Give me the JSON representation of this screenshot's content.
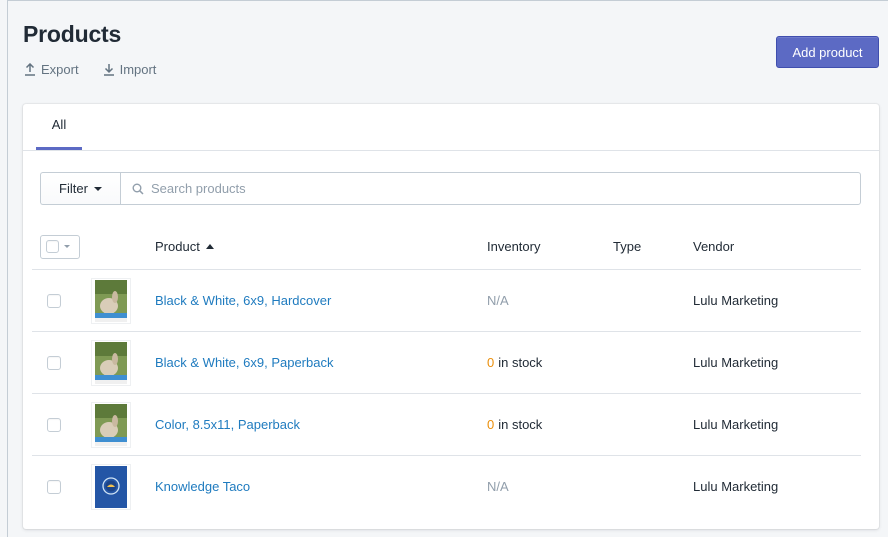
{
  "page": {
    "title": "Products",
    "export_label": "Export",
    "import_label": "Import",
    "add_product_label": "Add product"
  },
  "tabs": [
    {
      "label": "All",
      "selected": true
    }
  ],
  "filter": {
    "button_label": "Filter",
    "search_placeholder": "Search products"
  },
  "table": {
    "columns": {
      "product": "Product",
      "inventory": "Inventory",
      "type": "Type",
      "vendor": "Vendor"
    },
    "sort": {
      "column": "product",
      "direction": "ascending"
    },
    "rows": [
      {
        "name": "Black & White, 6x9, Hardcover",
        "inventory": "N/A",
        "inventory_count": "",
        "inventory_suffix": "",
        "type": "",
        "vendor": "Lulu Marketing",
        "thumbnail": "rabbit-cover-image"
      },
      {
        "name": "Black & White, 6x9, Paperback",
        "inventory": "",
        "inventory_count": "0",
        "inventory_suffix": "in stock",
        "type": "",
        "vendor": "Lulu Marketing",
        "thumbnail": "rabbit-cover-image"
      },
      {
        "name": "Color, 8.5x11, Paperback",
        "inventory": "",
        "inventory_count": "0",
        "inventory_suffix": "in stock",
        "type": "",
        "vendor": "Lulu Marketing",
        "thumbnail": "rabbit-cover-image"
      },
      {
        "name": "Knowledge Taco",
        "inventory": "N/A",
        "inventory_count": "",
        "inventory_suffix": "",
        "type": "",
        "vendor": "Lulu Marketing",
        "thumbnail": "blue-taco-cover-image"
      }
    ]
  },
  "colors": {
    "primary": "#5c6ac4",
    "link": "#1f7bbf",
    "stock_warning": "#eb8f0b",
    "muted": "#919eab"
  }
}
